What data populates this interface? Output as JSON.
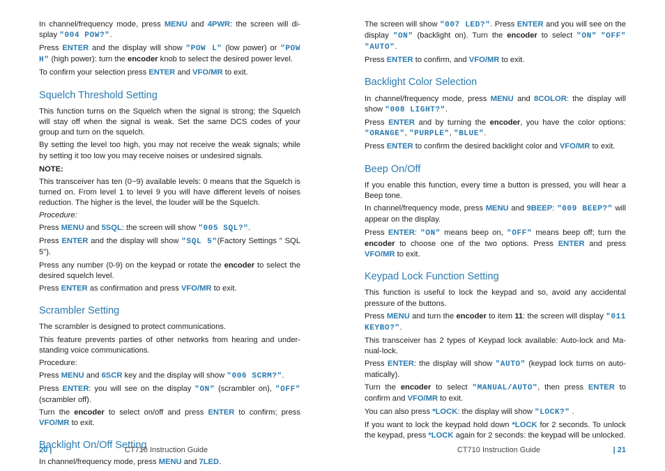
{
  "left": {
    "intro": {
      "p1_a": "In channel/frequency mode, press ",
      "menu": "MENU",
      "p1_b": " and ",
      "fourpwr": "4PWR",
      "p1_c": ": the screen will di­splay ",
      "q004": "\"004 POW?\"",
      "p1_d": ".",
      "p2_a": "Press ",
      "enter": "ENTER",
      "p2_b": " and the display will show ",
      "qpowl": "\"POW L\"",
      "p2_c": " (low power) or ",
      "qpowh": "\"POW H\"",
      "p2_d": " (high power): turn the ",
      "encoder": "encoder",
      "p2_e": " knob to select the desired power level.",
      "p3_a": "To confirm your selection press ",
      "p3_b": " and ",
      "vfomr": "VFO/MR",
      "p3_c": " to exit."
    },
    "sq": {
      "title": "Squelch Threshold Setting",
      "p1": "This function turns on the Squelch when the signal is strong; the Squelch will stay off when the signal is weak. Set the same DCS codes of your group and turn on the squelch.",
      "p2": "By setting the level too high, you may not receive the weak signals; while by setting it too low you may receive noises or undesired signals.",
      "note": "NOTE:",
      "p3": "This transceiver has ten (0~9) available levels: 0 means that the Squelch is turned on. From level 1 to level 9 you will have different levels of noises reduction. The higher is the level, the louder will be the Squelch.",
      "proc": "Procedure:",
      "p4_a": "Press ",
      "p4_b": " and ",
      "fivesql": "5SQL",
      "p4_c": ": the screen will show ",
      "q005": "\"005 SQL?\"",
      "p4_d": ".",
      "p5_a": "Press ",
      "p5_b": " and the display will show ",
      "qsql5": "\"SQL 5\"",
      "p5_c": "(Factory Settings \" SQL 5\").",
      "p6_a": "Press any number (0-9) on the keypad or rotate the ",
      "p6_b": " to select the desired squelch level.",
      "p7_a": "Press ",
      "p7_b": " as confirmation and press ",
      "p7_c": " to exit."
    },
    "scr": {
      "title": "Scrambler Setting",
      "p1": "The scrambler is designed to protect communications.",
      "p2": "This feature prevents parties of other networks from hearing and under­standing voice communications.",
      "proc": "Procedure:",
      "p3_a": "Press ",
      "p3_b": " and ",
      "sixscr": "6SCR",
      "p3_c": " key and the display will show ",
      "q006": "\"006 SCRM?\"",
      "p3_d": ".",
      "p4_a": "Press ",
      "p4_b": ": you will see on the display ",
      "qon": "\"ON\"",
      "p4_c": " (scrambler on), ",
      "qoff": "\"OFF\"",
      "p4_d": " (scrambler off).",
      "p5_a": "Turn the ",
      "p5_b": " to select on/off and press ",
      "p5_c": " to confirm; press ",
      "p5_d": " to exit."
    },
    "bl": {
      "title": "Backlight On/Off Setting",
      "p1_a": "In channel/frequency mode, press ",
      "p1_b": " and ",
      "sevenled": "7LED",
      "p1_c": "."
    },
    "footer_page": "20 |",
    "footer_guide": "CT710 Instruction Guide"
  },
  "right": {
    "cont": {
      "p1_a": "The screen will show ",
      "q007": "\"007 LED?\"",
      "p1_b": ". Press ",
      "enter": "ENTER",
      "p1_c": " and you will see on the display ",
      "qon": "\"ON\"",
      "p1_d": " (backlight on). Turn the ",
      "encoder": "encoder",
      "p1_e": " to select ",
      "qon2": "\"ON\"",
      "qoff": "\"OFF\"",
      "qauto": "\"AUTO\"",
      "p1_f": ".",
      "p2_a": "Press ",
      "p2_b": " to confirm, and ",
      "vfomr": "VFO/MR",
      "p2_c": " to exit."
    },
    "bc": {
      "title": "Backlight Color Selection",
      "p1_a": "In channel/frequency mode, press ",
      "menu": "MENU",
      "p1_b": " and ",
      "eightcolor": "8COLOR",
      "p1_c": ": the display will show ",
      "q008": "\"008 LIGHT?\"",
      "p1_d": ".",
      "p2_a": "Press ",
      "p2_b": " and by turning the ",
      "p2_c": ", you have the color options: ",
      "qorange": "\"ORANGE\"",
      "qpurple": "\"PURPLE\"",
      "qblue": "\"BLUE\"",
      "p2_d": ".",
      "p3_a": "Press ",
      "p3_b": " to confirm the desired backlight color and ",
      "p3_c": " to exit."
    },
    "beep": {
      "title": "Beep On/Off",
      "p1": "If you enable this function, every time a button is pressed, you will hear a Beep tone.",
      "p2_a": "In channel/frequency mode, press ",
      "p2_b": " and ",
      "ninebeep": "9BEEP",
      "p2_c": ": ",
      "q009": "\"009 BEEP?\"",
      "p2_d": " will appear on the display.",
      "p3_a": "Press ",
      "p3_b": ": ",
      "qon": "\"ON\"",
      "p3_c": " means beep on, ",
      "qoff": "\"OFF\"",
      "p3_d": " means beep off; turn the ",
      "encoder2": "enco­der",
      "p3_e": " to choose one of the two options. Press ",
      "p3_f": " and press ",
      "p3_g": " to exit."
    },
    "kl": {
      "title": "Keypad Lock Function Setting",
      "p1": "This function is useful to lock the keypad and so, avoid any accidental pressure of the buttons.",
      "p2_a": "Press ",
      "p2_b": " and turn the ",
      "p2_c": " to item ",
      "eleven": "11",
      "p2_d": ": the screen will display ",
      "q011": "\"011 KEYBO?\"",
      "p2_e": ".",
      "p3": "This transceiver has 2 types of Keypad lock available: Auto-lock and Ma­nual-lock.",
      "p4_a": "Press ",
      "p4_b": ": the display will show ",
      "qauto": "\"AUTO\"",
      "p4_c": " (keypad lock turns on auto­matically).",
      "p5_a": "Turn the ",
      "p5_b": " to select ",
      "qmanual": "\"MANUAL/AUTO\"",
      "p5_c": ", then press ",
      "p5_d": " to confirm and ",
      "p5_e": " to exit.",
      "p6_a": "You can also press ",
      "starlock": "*LOCK",
      "p6_b": ": the display will show ",
      "qlock": "\"LOCK?\"",
      "p6_c": " .",
      "p7_a": "If you want to lock the keypad hold down ",
      "p7_b": " for 2 seconds. To unlock the keypad, press ",
      "p7_c": " again for 2 seconds: the keypad will be unlo­cked."
    },
    "footer_page": "| 21",
    "footer_guide": "CT710 Instruction Guide"
  }
}
